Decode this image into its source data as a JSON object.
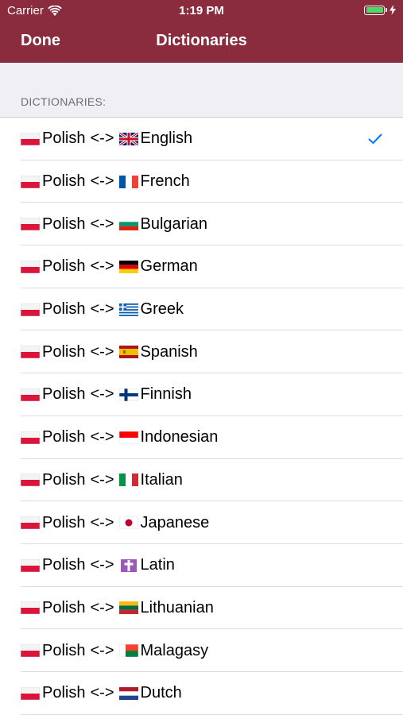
{
  "status": {
    "carrier": "Carrier",
    "time": "1:19 PM",
    "battery_level": 1.0
  },
  "nav": {
    "done_label": "Done",
    "title": "Dictionaries"
  },
  "section": {
    "header": "DICTIONARIES:"
  },
  "colors": {
    "header_bg": "#8a2b3e",
    "accent": "#007aff",
    "battery_green": "#4cd964"
  },
  "dictionaries": [
    {
      "source_flag": "poland-flag-icon",
      "source": "Polish",
      "separator": "<->",
      "target_flag": "uk-flag-icon",
      "target": "English",
      "selected": true
    },
    {
      "source_flag": "poland-flag-icon",
      "source": "Polish",
      "separator": "<->",
      "target_flag": "france-flag-icon",
      "target": "French",
      "selected": false
    },
    {
      "source_flag": "poland-flag-icon",
      "source": "Polish",
      "separator": "<->",
      "target_flag": "bulgaria-flag-icon",
      "target": "Bulgarian",
      "selected": false
    },
    {
      "source_flag": "poland-flag-icon",
      "source": "Polish",
      "separator": "<->",
      "target_flag": "germany-flag-icon",
      "target": "German",
      "selected": false
    },
    {
      "source_flag": "poland-flag-icon",
      "source": "Polish",
      "separator": "<->",
      "target_flag": "greece-flag-icon",
      "target": "Greek",
      "selected": false
    },
    {
      "source_flag": "poland-flag-icon",
      "source": "Polish",
      "separator": "<->",
      "target_flag": "spain-flag-icon",
      "target": "Spanish",
      "selected": false
    },
    {
      "source_flag": "poland-flag-icon",
      "source": "Polish",
      "separator": "<->",
      "target_flag": "finland-flag-icon",
      "target": "Finnish",
      "selected": false
    },
    {
      "source_flag": "poland-flag-icon",
      "source": "Polish",
      "separator": "<->",
      "target_flag": "indonesia-flag-icon",
      "target": "Indonesian",
      "selected": false
    },
    {
      "source_flag": "poland-flag-icon",
      "source": "Polish",
      "separator": "<->",
      "target_flag": "italy-flag-icon",
      "target": "Italian",
      "selected": false
    },
    {
      "source_flag": "poland-flag-icon",
      "source": "Polish",
      "separator": "<->",
      "target_flag": "japan-flag-icon",
      "target": "Japanese",
      "selected": false
    },
    {
      "source_flag": "poland-flag-icon",
      "source": "Polish",
      "separator": "<->",
      "target_flag": "latin-cross-icon",
      "target": "Latin",
      "selected": false
    },
    {
      "source_flag": "poland-flag-icon",
      "source": "Polish",
      "separator": "<->",
      "target_flag": "lithuania-flag-icon",
      "target": "Lithuanian",
      "selected": false
    },
    {
      "source_flag": "poland-flag-icon",
      "source": "Polish",
      "separator": "<->",
      "target_flag": "madagascar-flag-icon",
      "target": "Malagasy",
      "selected": false
    },
    {
      "source_flag": "poland-flag-icon",
      "source": "Polish",
      "separator": "<->",
      "target_flag": "netherlands-flag-icon",
      "target": "Dutch",
      "selected": false
    }
  ]
}
